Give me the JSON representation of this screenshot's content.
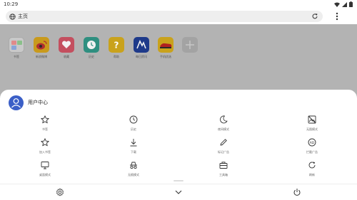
{
  "status_bar": {
    "time": "10:29"
  },
  "address_bar": {
    "text": "主页"
  },
  "shortcuts": [
    {
      "label": "书签",
      "icon": "folder-icon"
    },
    {
      "label": "新浪微博",
      "icon": "weibo-icon"
    },
    {
      "label": "收藏",
      "icon": "heart-icon"
    },
    {
      "label": "历史",
      "icon": "clock-icon"
    },
    {
      "label": "帮助",
      "icon": "help-icon"
    },
    {
      "label": "每日资讯",
      "icon": "news-icon"
    },
    {
      "label": "手机优选",
      "icon": "shoe-icon"
    },
    {
      "label": "",
      "icon": "add-icon"
    }
  ],
  "sheet": {
    "title": "用户中心",
    "items": [
      {
        "label": "书签",
        "icon": "star-icon"
      },
      {
        "label": "历史",
        "icon": "clock-icon"
      },
      {
        "label": "夜间模式",
        "icon": "moon-icon"
      },
      {
        "label": "无图模式",
        "icon": "no-image-icon"
      },
      {
        "label": "加入书签",
        "icon": "star-outline-icon"
      },
      {
        "label": "下载",
        "icon": "download-icon"
      },
      {
        "label": "标记广告",
        "icon": "pencil-icon"
      },
      {
        "label": "拦截广告",
        "icon": "ad-block-icon"
      },
      {
        "label": "桌面模式",
        "icon": "desktop-icon"
      },
      {
        "label": "无痕模式",
        "icon": "incognito-icon"
      },
      {
        "label": "工具箱",
        "icon": "toolbox-icon"
      },
      {
        "label": "刷新",
        "icon": "refresh-icon"
      }
    ]
  },
  "colors": {
    "scrim": "#b3b3b3",
    "accent": "#3b5fc7"
  }
}
